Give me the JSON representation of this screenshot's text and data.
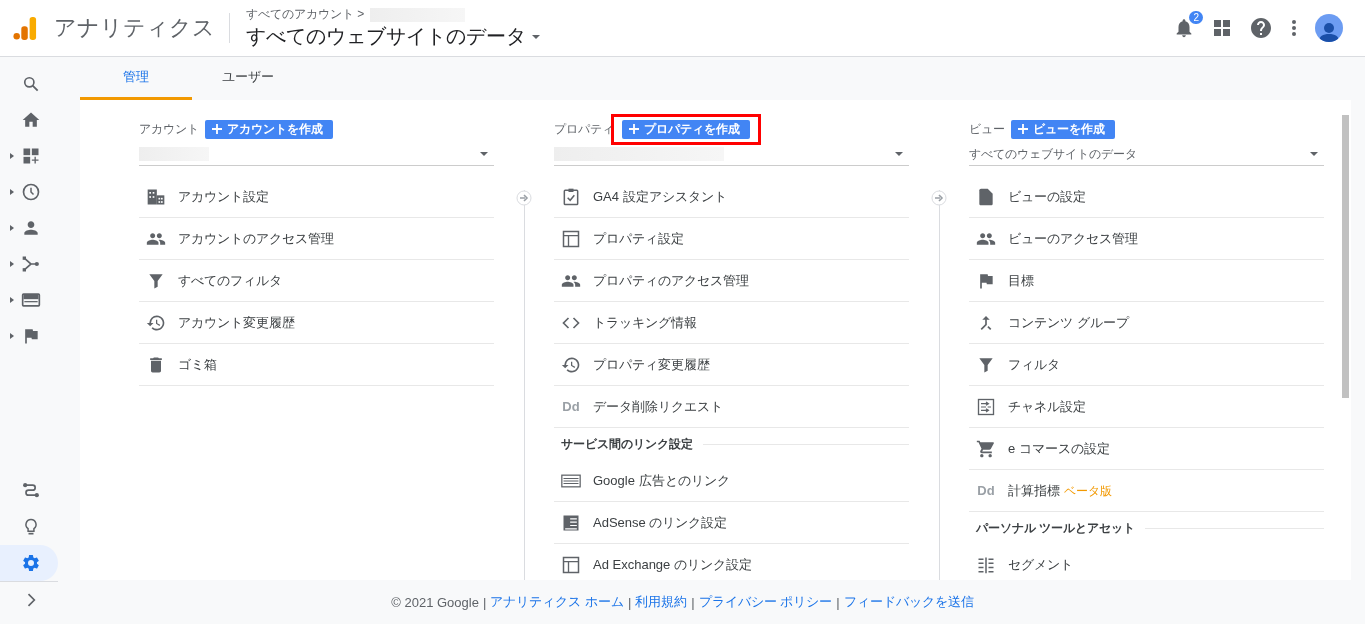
{
  "header": {
    "app_name": "アナリティクス",
    "breadcrumb": "すべてのアカウント >",
    "breadcrumb_redacted": true,
    "view_title": "すべてのウェブサイトのデータ",
    "notification_count": "2"
  },
  "nav": {
    "top": [
      {
        "kind": "search",
        "expandable": false,
        "selected": false
      },
      {
        "kind": "home",
        "expandable": false,
        "selected": false
      },
      {
        "kind": "dashboard",
        "expandable": true,
        "selected": false
      },
      {
        "kind": "clock",
        "expandable": true,
        "selected": false
      },
      {
        "kind": "person",
        "expandable": true,
        "selected": false
      },
      {
        "kind": "flow",
        "expandable": true,
        "selected": false
      },
      {
        "kind": "display",
        "expandable": true,
        "selected": false
      },
      {
        "kind": "flag",
        "expandable": true,
        "selected": false
      }
    ],
    "bottom": [
      {
        "kind": "route",
        "expandable": false,
        "selected": false
      },
      {
        "kind": "bulb",
        "expandable": false,
        "selected": false
      },
      {
        "kind": "gear",
        "expandable": false,
        "selected": true
      },
      {
        "kind": "chevron",
        "expandable": false,
        "selected": false
      }
    ]
  },
  "tabs": [
    {
      "label": "管理",
      "selected": true
    },
    {
      "label": "ユーザー",
      "selected": false
    }
  ],
  "columns": [
    {
      "label": "アカウント",
      "create_button": "アカウントを作成",
      "highlighted": false,
      "selector": {
        "redacted": true
      },
      "items": [
        {
          "kind": "building",
          "label": "アカウント設定"
        },
        {
          "kind": "group",
          "label": "アカウントのアクセス管理"
        },
        {
          "kind": "filter",
          "label": "すべてのフィルタ"
        },
        {
          "kind": "history",
          "label": "アカウント変更履歴"
        },
        {
          "kind": "trash",
          "label": "ゴミ箱"
        }
      ]
    },
    {
      "label": "プロパティ",
      "create_button": "プロパティを作成",
      "highlighted": true,
      "selector": {
        "redacted": true
      },
      "items": [
        {
          "kind": "clipboard",
          "label": "GA4 設定アシスタント"
        },
        {
          "kind": "layout",
          "label": "プロパティ設定"
        },
        {
          "kind": "group",
          "label": "プロパティのアクセス管理"
        },
        {
          "kind": "code",
          "label": "トラッキング情報"
        },
        {
          "kind": "history",
          "label": "プロパティ変更履歴"
        },
        {
          "kind": "letters",
          "icon_text": "Dd",
          "label": "データ削除リクエスト"
        },
        {
          "kind": "heading",
          "label": "サービス間のリンク設定"
        },
        {
          "kind": "ads",
          "label": "Google 広告とのリンク"
        },
        {
          "kind": "newspaper",
          "label": "AdSense のリンク設定"
        },
        {
          "kind": "layout",
          "label": "Ad Exchange のリンク設定"
        }
      ]
    },
    {
      "label": "ビュー",
      "create_button": "ビューを作成",
      "highlighted": false,
      "selector": {
        "value": "すべてのウェブサイトのデータ"
      },
      "items": [
        {
          "kind": "page",
          "label": "ビューの設定"
        },
        {
          "kind": "group",
          "label": "ビューのアクセス管理"
        },
        {
          "kind": "flag",
          "label": "目標"
        },
        {
          "kind": "merge",
          "label": "コンテンツ グループ"
        },
        {
          "kind": "filter",
          "label": "フィルタ"
        },
        {
          "kind": "channel",
          "label": "チャネル設定"
        },
        {
          "kind": "cart",
          "label": "e コマースの設定"
        },
        {
          "kind": "letters",
          "icon_text": "Dd",
          "label": "計算指標",
          "badge": "ベータ版"
        },
        {
          "kind": "heading",
          "label": "パーソナル ツールとアセット"
        },
        {
          "kind": "segment",
          "label": "セグメント"
        }
      ]
    }
  ],
  "footer": {
    "copyright": "© 2021 Google",
    "separator": "|",
    "links": [
      "アナリティクス ホーム",
      "利用規約",
      "プライバシー ポリシー",
      "フィードバックを送信"
    ]
  }
}
